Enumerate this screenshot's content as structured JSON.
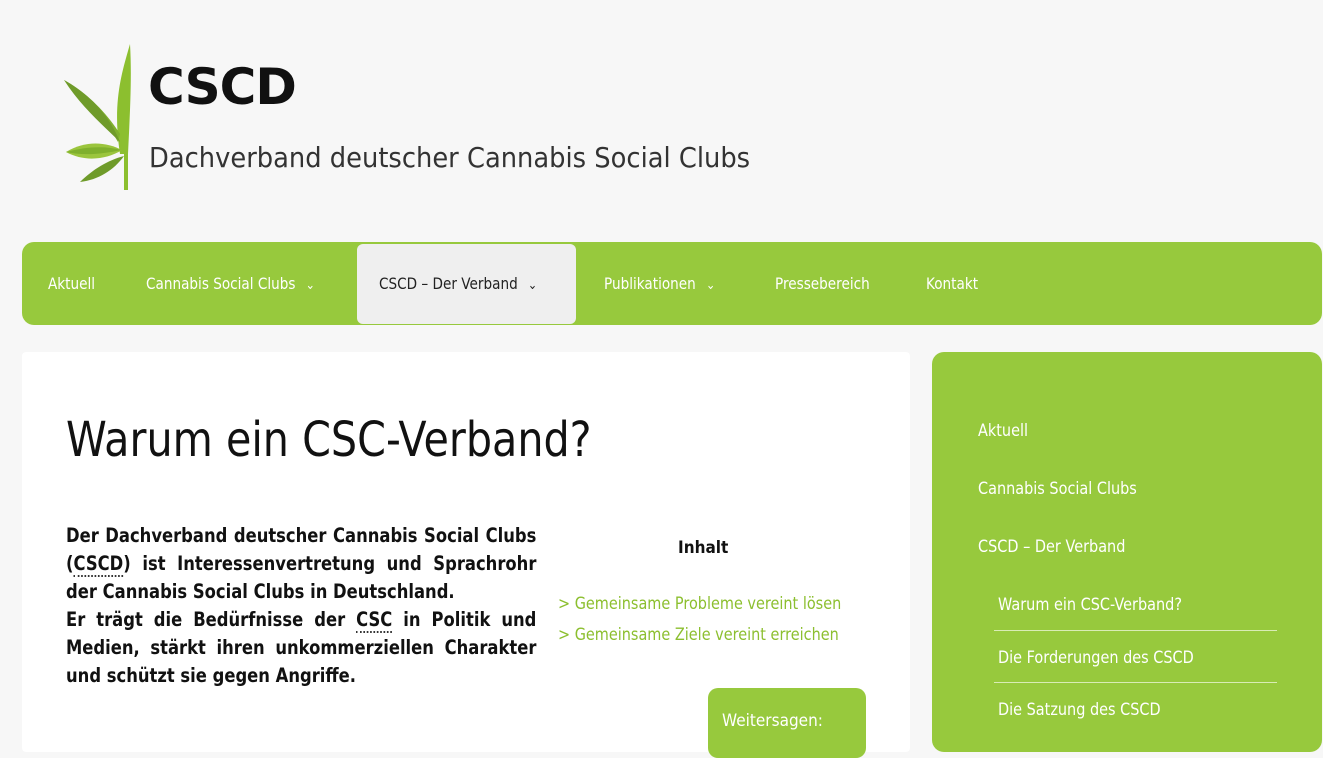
{
  "header": {
    "title": "CSCD",
    "tagline": "Dachverband deutscher Cannabis Social Clubs",
    "logo_icon": "cannabis-leaf-icon"
  },
  "nav": {
    "items": [
      {
        "label": "Aktuell"
      },
      {
        "label": "Cannabis Social Clubs"
      },
      {
        "label": "CSCD – Der Verband"
      },
      {
        "label": "Publikationen"
      },
      {
        "label": "Pressebereich"
      },
      {
        "label": "Kontakt"
      }
    ],
    "dropdown_glyph": "⌄",
    "active_index": 2
  },
  "main": {
    "title": "Warum ein CSC-Verband?",
    "intro": {
      "p1_before": "Der Dachverband deutscher Cannabis Social Clubs (",
      "p1_abbr": "CSCD",
      "p1_after": ") ist Interessenvertretung und Sprachrohr der Cannabis Social Clubs in Deutschland.",
      "p2_before": "Er trägt die Bedürfnisse der ",
      "p2_abbr": "CSC",
      "p2_after": " in Politik und Medien, stärkt ihren unkommerziellen Charakter und schützt sie gegen Angriffe."
    },
    "toc": {
      "title": "Inhalt",
      "links": [
        "> Gemeinsame Probleme vereint lösen",
        "> Gemeinsame Ziele vereint erreichen"
      ]
    },
    "share_label": "Weitersagen:"
  },
  "sidebar": {
    "items": [
      {
        "label": "Aktuell"
      },
      {
        "label": "Cannabis Social Clubs"
      },
      {
        "label": "CSCD – Der Verband"
      }
    ],
    "subitems": [
      {
        "label": "Warum ein CSC-Verband?"
      },
      {
        "label": "Die Forderungen des CSCD"
      },
      {
        "label": "Die Satzung des CSCD"
      }
    ]
  },
  "colors": {
    "accent": "#97c93d",
    "link": "#8cbf2f",
    "leaf_dark": "#6f9b2a",
    "leaf_light": "#9bc53d"
  }
}
